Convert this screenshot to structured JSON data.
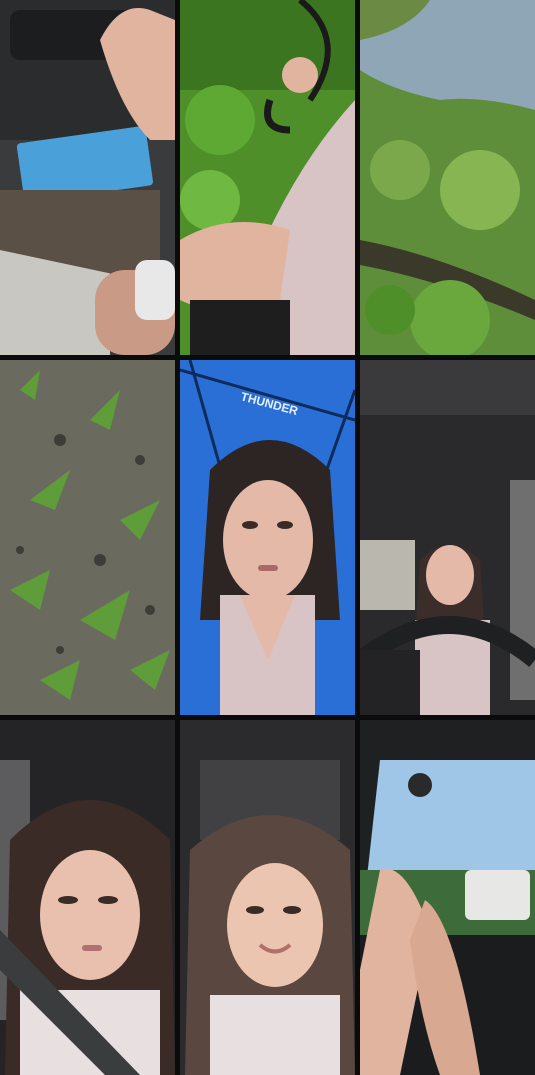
{
  "collage": {
    "tiles": [
      {
        "subject": "hand-opening-car-door"
      },
      {
        "subject": "holding-umbrella-over-greenery"
      },
      {
        "subject": "wet-grass-and-stream"
      },
      {
        "subject": "grass-and-gravel-ground"
      },
      {
        "subject": "selfie-under-blue-umbrella"
      },
      {
        "subject": "driver-seat-with-steering-wheel"
      },
      {
        "subject": "selfie-seatbelt-in-car"
      },
      {
        "subject": "smiling-selfie-in-car"
      },
      {
        "subject": "feet-on-dashboard-view"
      }
    ]
  },
  "colors": {
    "background": "#000000",
    "foliage": "#4f8f2a",
    "umbrella_blue": "#2a6fd6",
    "satin_pajama": "#d8c3c5",
    "car_interior": "#2a2a2c",
    "sky": "#9fc6e6"
  },
  "umbrella_print": {
    "text": "THUNDER"
  }
}
